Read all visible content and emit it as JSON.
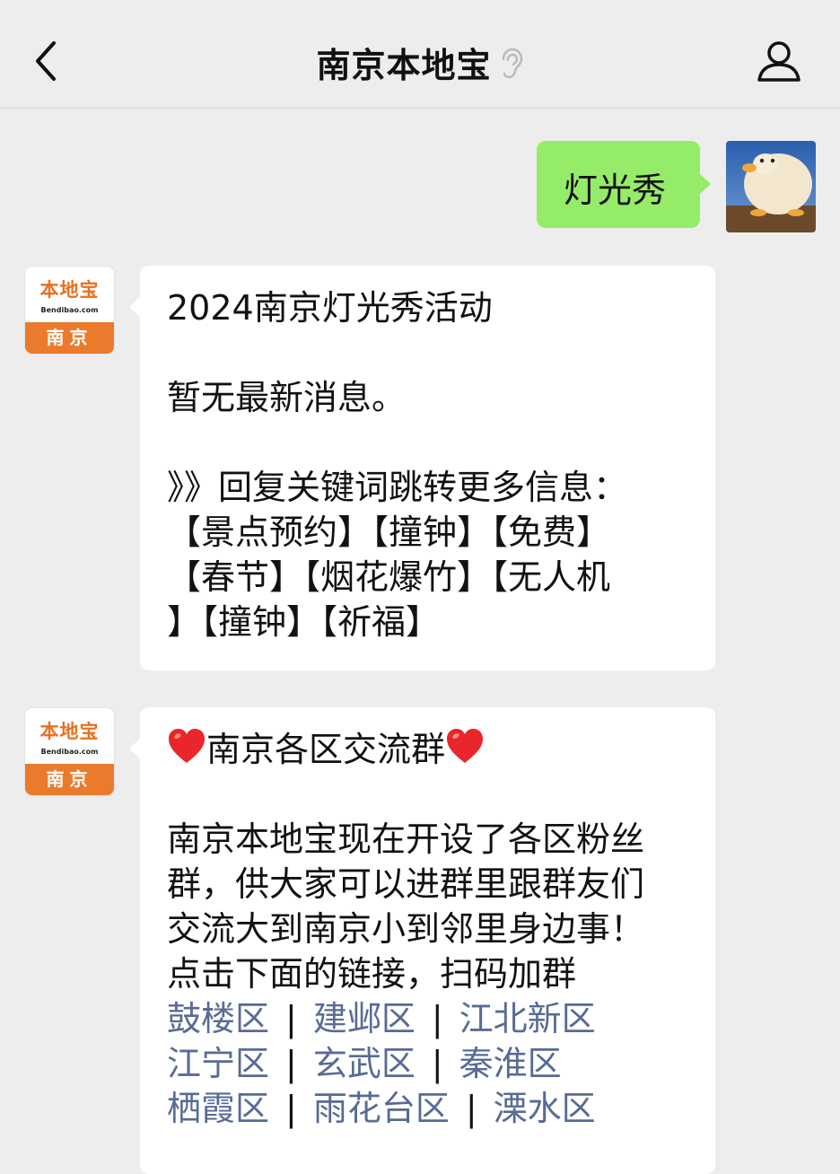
{
  "header": {
    "title": "南京本地宝"
  },
  "messages": {
    "outgoing": {
      "text": "灯光秀"
    },
    "logo": {
      "cn": "本地宝",
      "en": "Bendibao.com",
      "city": "南京"
    },
    "reply1": {
      "title": "2024南京灯光秀活动",
      "status": "暂无最新消息。",
      "prompt": "》》回复关键词跳转更多信息：",
      "keywords_line1": "【景点预约】【撞钟】【免费】",
      "keywords_line2": "【春节】【烟花爆竹】【无人机",
      "keywords_line3": "】【撞钟】【祈福】"
    },
    "reply2": {
      "title": "南京各区交流群",
      "body_line1": "南京本地宝现在开设了各区粉丝",
      "body_line2": "群，供大家可以进群里跟群友们",
      "body_line3": "交流大到南京小到邻里身边事！",
      "body_line4": "点击下面的链接，扫码加群",
      "separator": "|",
      "links": [
        [
          "鼓楼区",
          "建邺区",
          "江北新区"
        ],
        [
          "江宁区",
          "玄武区",
          "秦淮区"
        ],
        [
          "栖霞区",
          "雨花台区",
          "溧水区"
        ]
      ]
    }
  },
  "colors": {
    "outgoing_bubble": "#95ec69",
    "link": "#576b95",
    "logo_orange": "#ea7b2c"
  }
}
